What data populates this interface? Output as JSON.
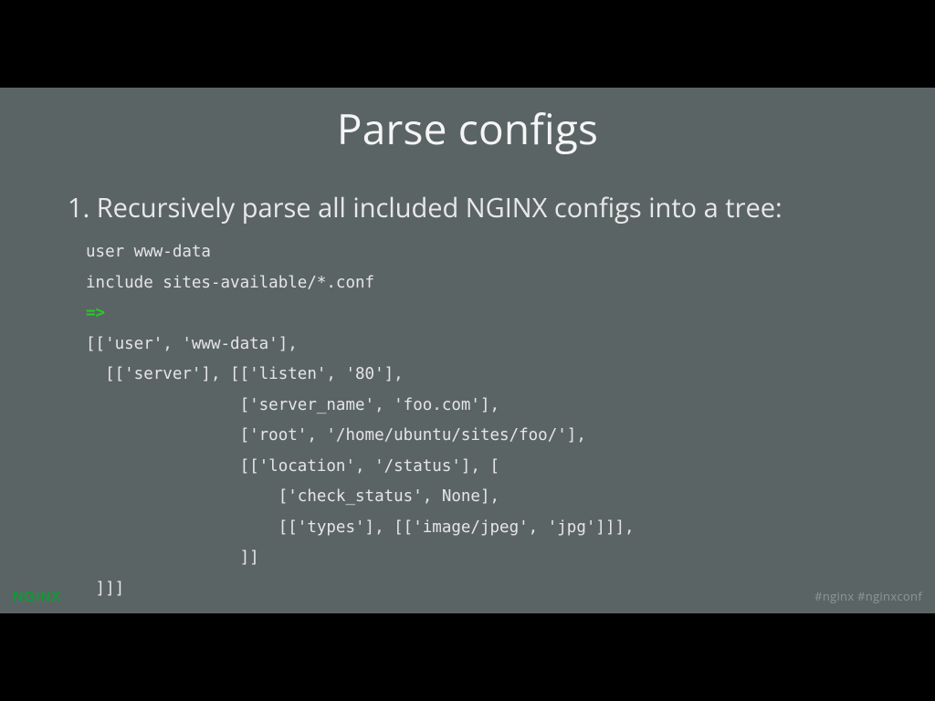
{
  "slide": {
    "title": "Parse configs",
    "step_prefix": "1. ",
    "step_text": "Recursively parse all included NGINX configs into a tree:",
    "code_lines": [
      {
        "text": "user www-data",
        "cls": ""
      },
      {
        "text": "include sites-available/*.conf",
        "cls": ""
      },
      {
        "text": "=>",
        "cls": "arrow"
      },
      {
        "text": "[['user', 'www-data'],",
        "cls": ""
      },
      {
        "text": "  [['server'], [['listen', '80'],",
        "cls": ""
      },
      {
        "text": "                ['server_name', 'foo.com'],",
        "cls": ""
      },
      {
        "text": "                ['root', '/home/ubuntu/sites/foo/'],",
        "cls": ""
      },
      {
        "text": "                [['location', '/status'], [",
        "cls": ""
      },
      {
        "text": "                    ['check_status', None],",
        "cls": ""
      },
      {
        "text": "                    [['types'], [['image/jpeg', 'jpg']]],",
        "cls": ""
      },
      {
        "text": "                ]]",
        "cls": ""
      },
      {
        "text": " ]]]",
        "cls": ""
      }
    ]
  },
  "footer": {
    "logo": "NGiNX",
    "hashtags": "#nginx  #nginxconf"
  },
  "colors": {
    "brand_green": "#149639",
    "arrow_green": "#20d020",
    "slide_bg": "#5b6465"
  }
}
